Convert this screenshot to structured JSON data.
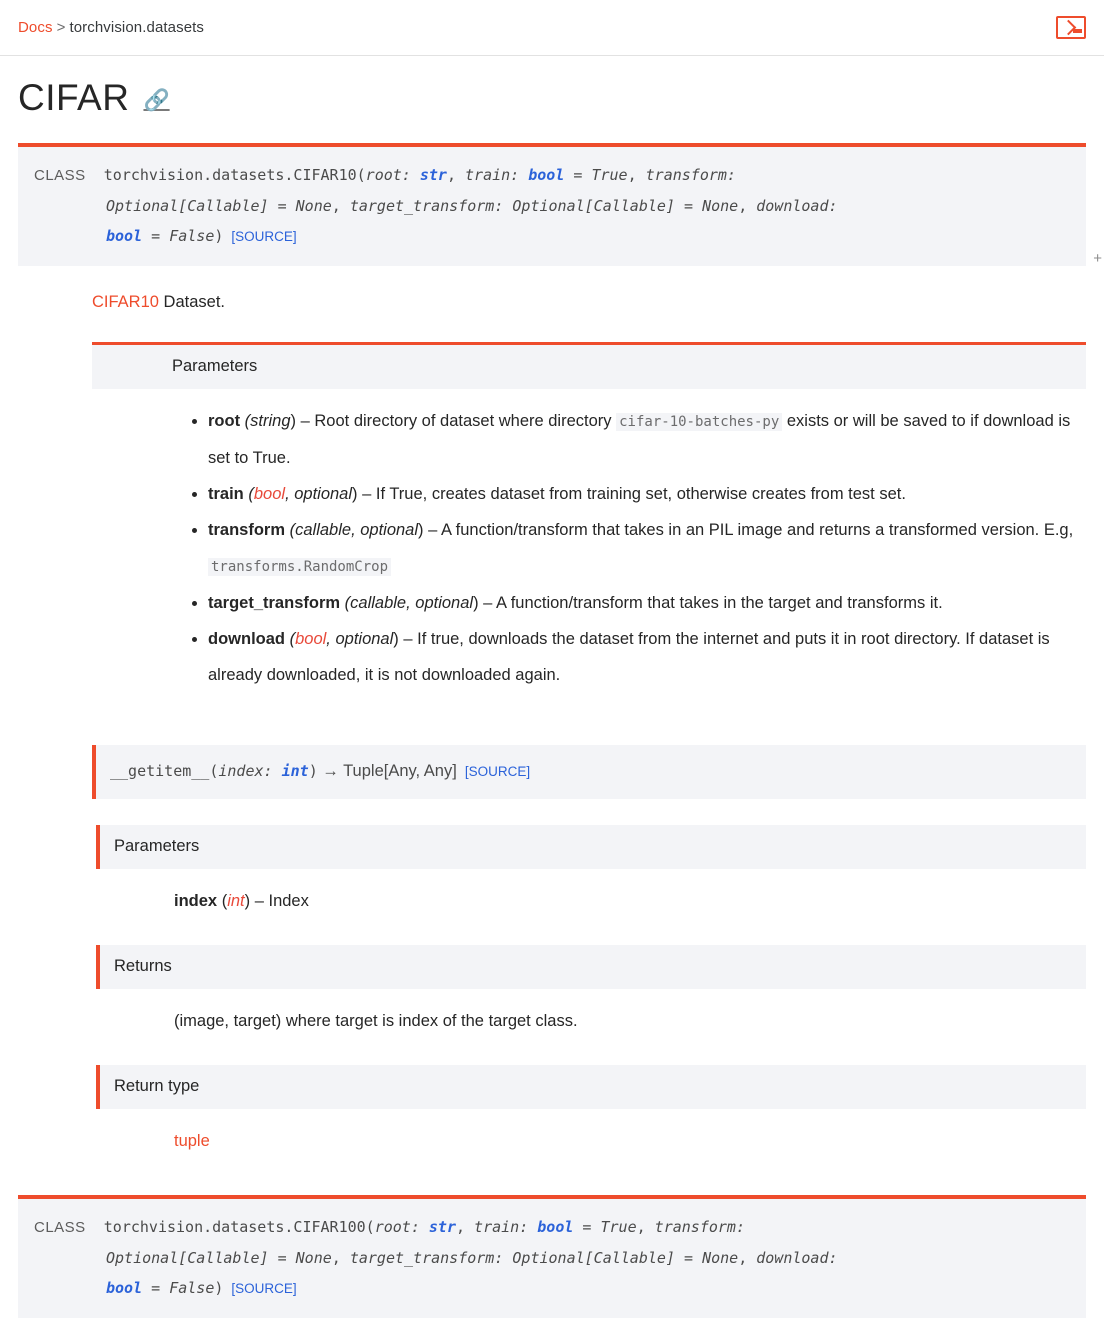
{
  "header": {
    "breadcrumb": {
      "root_label": "Docs",
      "separator": ">",
      "current_label": "torchvision.datasets"
    },
    "console_icon_name": "terminal-icon"
  },
  "page": {
    "title": "CIFAR",
    "anchor_icon": "link-icon",
    "scroll_marker": "+"
  },
  "cifar10": {
    "keyword": "CLASS",
    "qualname": "torchvision.datasets.CIFAR10",
    "open_paren": "(",
    "params": [
      {
        "name": "root",
        "colon": ": ",
        "type": "str",
        "sep": ", "
      },
      {
        "name": "train",
        "colon": ": ",
        "type": "bool",
        "eq": " = ",
        "default": "True",
        "sep": ", "
      },
      {
        "name": "transform",
        "colon": ": ",
        "type": "Optional[Callable]",
        "eq": " = ",
        "default": "None",
        "sep": ", "
      },
      {
        "name": "target_transform",
        "colon": ": ",
        "type": "Optional[Callable]",
        "eq": " = ",
        "default": "None",
        "sep": ", "
      },
      {
        "name": "download",
        "colon": ": ",
        "type": "bool",
        "eq": " = ",
        "default": "False"
      }
    ],
    "close_paren": ")",
    "source_label": "[SOURCE]",
    "description_link": "CIFAR10",
    "description_rest": " Dataset.",
    "parameters_heading": "Parameters",
    "parameter_items": [
      {
        "name": "root",
        "type_open": " (",
        "type": "string",
        "type_red": "",
        "type_close": ") ",
        "dash": "– ",
        "desc_before": "Root directory of dataset where directory ",
        "literal": "cifar-10-batches-py",
        "desc_after": " exists or will be saved to if download is set to True."
      },
      {
        "name": "train",
        "type_open": " (",
        "type_red": "bool",
        "type": ", optional",
        "type_close": ") ",
        "dash": "– ",
        "desc_before": "If True, creates dataset from training set, otherwise creates from test set.",
        "literal": "",
        "desc_after": ""
      },
      {
        "name": "transform",
        "type_open": " (",
        "type_red": "",
        "type": "callable, optional",
        "type_close": ") ",
        "dash": "– ",
        "desc_before": "A function/transform that takes in an PIL image and returns a transformed version. E.g, ",
        "literal": "transforms.RandomCrop",
        "desc_after": ""
      },
      {
        "name": "target_transform",
        "type_open": " (",
        "type_red": "",
        "type": "callable, optional",
        "type_close": ") ",
        "dash": "– ",
        "desc_before": "A function/transform that takes in the target and transforms it.",
        "literal": "",
        "desc_after": ""
      },
      {
        "name": "download",
        "type_open": " (",
        "type_red": "bool",
        "type": ", optional",
        "type_close": ") ",
        "dash": "– ",
        "desc_before": "If true, downloads the dataset from the internet and puts it in root directory. If dataset is already downloaded, it is not downloaded again.",
        "literal": "",
        "desc_after": ""
      }
    ]
  },
  "getitem": {
    "name": "__getitem__",
    "open_paren": "(",
    "param_name": "index",
    "param_colon": ": ",
    "param_type": "int",
    "close_paren": ")",
    "arrow": " → ",
    "return_annotation": "Tuple[Any, Any]",
    "source_label": "[SOURCE]",
    "parameters_heading": "Parameters",
    "param_item_name": "index",
    "param_item_type_open": " (",
    "param_item_type": "int",
    "param_item_type_close": ") ",
    "param_item_dash": "– ",
    "param_item_desc": "Index",
    "returns_heading": "Returns",
    "returns_text": "(image, target) where target is index of the target class.",
    "return_type_heading": "Return type",
    "return_type_value": "tuple"
  },
  "cifar100": {
    "keyword": "CLASS",
    "qualname": "torchvision.datasets.CIFAR100",
    "open_paren": "(",
    "params": [
      {
        "name": "root",
        "colon": ": ",
        "type": "str",
        "sep": ", "
      },
      {
        "name": "train",
        "colon": ": ",
        "type": "bool",
        "eq": " = ",
        "default": "True",
        "sep": ", "
      },
      {
        "name": "transform",
        "colon": ": ",
        "type": "Optional[Callable]",
        "eq": " = ",
        "default": "None",
        "sep": ", "
      },
      {
        "name": "target_transform",
        "colon": ": ",
        "type": "Optional[Callable]",
        "eq": " = ",
        "default": "None",
        "sep": ", "
      },
      {
        "name": "download",
        "colon": ": ",
        "type": "bool",
        "eq": " = ",
        "default": "False"
      }
    ],
    "close_paren": ")",
    "source_label": "[SOURCE]"
  },
  "colors": {
    "accent": "#ee4c2c",
    "code_bg": "#f3f4f7",
    "type_blue": "#2b62d9",
    "text": "#262626"
  }
}
